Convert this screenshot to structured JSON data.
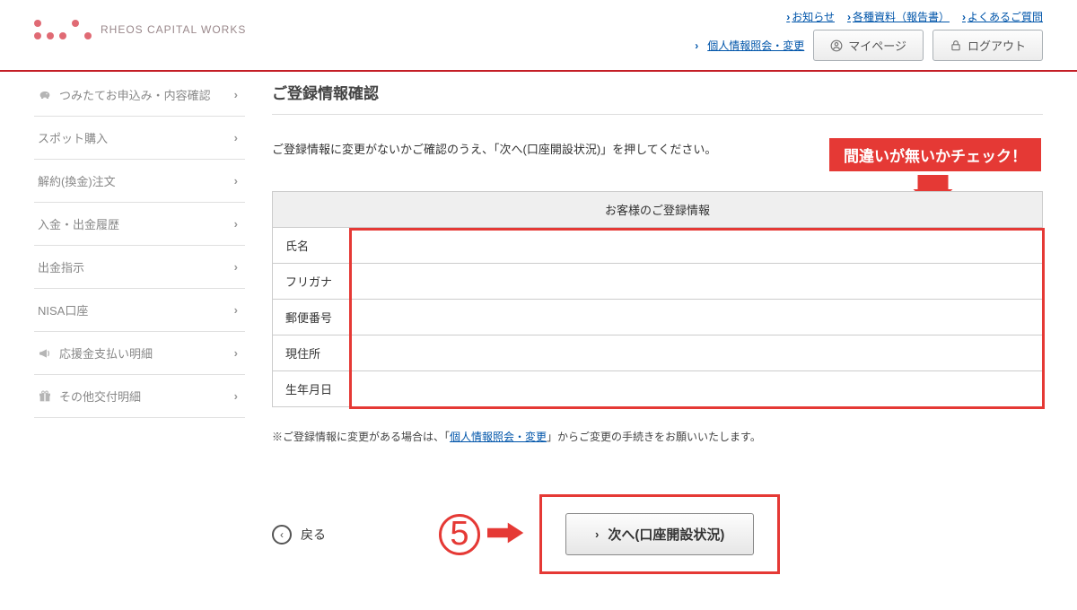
{
  "header": {
    "logo_text": "RHEOS CAPITAL WORKS",
    "top_links": [
      {
        "label": "お知らせ"
      },
      {
        "label": "各種資料（報告書）"
      },
      {
        "label": "よくあるご質問"
      }
    ],
    "personal_info_link": "個人情報照会・変更",
    "mypage_label": "マイページ",
    "logout_label": "ログアウト"
  },
  "sidebar": {
    "items": [
      {
        "label": "つみたてお申込み・内容確認"
      },
      {
        "label": "スポット購入"
      },
      {
        "label": "解約(換金)注文"
      },
      {
        "label": "入金・出金履歴"
      },
      {
        "label": "出金指示"
      },
      {
        "label": "NISA口座"
      },
      {
        "label": "応援金支払い明細"
      },
      {
        "label": "その他交付明細"
      }
    ]
  },
  "content": {
    "page_title": "ご登録情報確認",
    "lead": "ご登録情報に変更がないかご確認のうえ、「次へ(口座開設状況)」を押してください。",
    "callout": "間違いが無いかチェック！",
    "table": {
      "header": "お客様のご登録情報",
      "rows": [
        {
          "label": "氏名",
          "value": ""
        },
        {
          "label": "フリガナ",
          "value": ""
        },
        {
          "label": "郵便番号",
          "value": ""
        },
        {
          "label": "現住所",
          "value": ""
        },
        {
          "label": "生年月日",
          "value": ""
        }
      ]
    },
    "note_prefix": "※ご登録情報に変更がある場合は、「",
    "note_link": "個人情報照会・変更",
    "note_suffix": "」からご変更の手続きをお願いいたします。",
    "back_label": "戻る",
    "step_number": "⑤",
    "next_label": "次へ(口座開設状況)"
  }
}
